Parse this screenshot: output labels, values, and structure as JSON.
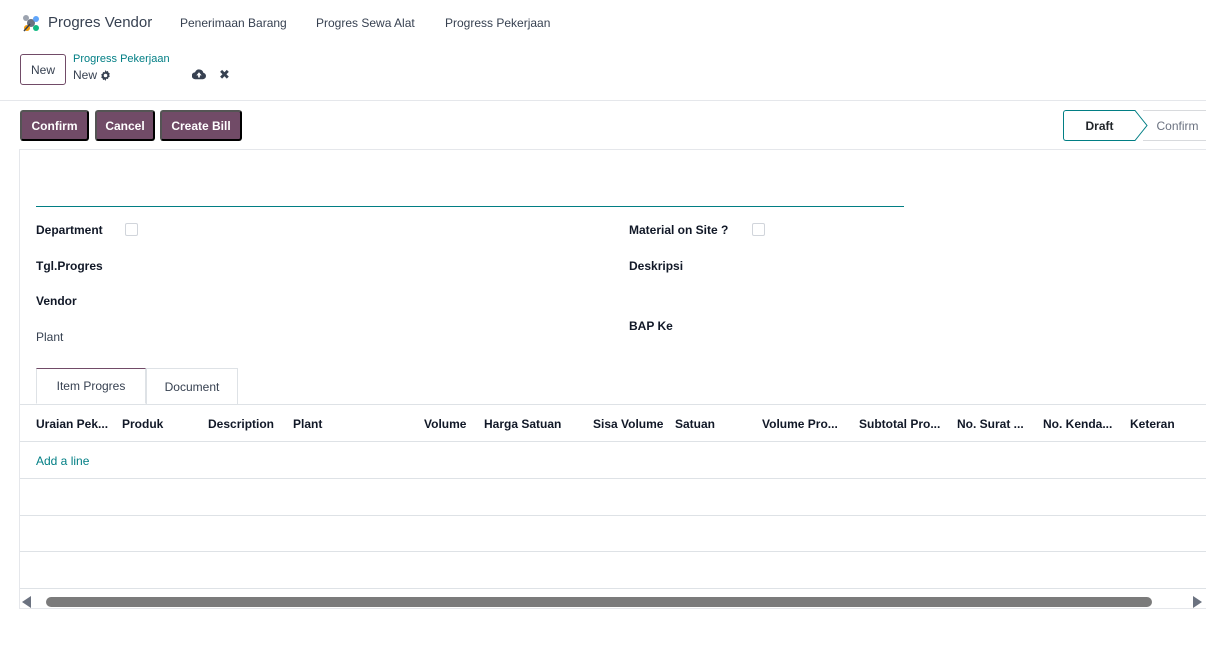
{
  "app": {
    "icon": "app-logo-icon",
    "title": "Progres Vendor",
    "menu": [
      "Penerimaan Barang",
      "Progres Sewa Alat",
      "Progress Pekerjaan"
    ]
  },
  "control_panel": {
    "new_label": "New",
    "breadcrumb": "Progress Pekerjaan",
    "record_name": "New",
    "gear_icon": "gear-icon",
    "save_icon": "cloud-upload-icon",
    "discard_icon": "close-icon"
  },
  "actions": {
    "confirm": "Confirm",
    "cancel": "Cancel",
    "create_bill": "Create Bill"
  },
  "statusbar": {
    "stages": [
      "Draft",
      "Confirm"
    ],
    "current": "Draft"
  },
  "form": {
    "department_label": "Department",
    "tgl_progres_label": "Tgl.Progres",
    "vendor_label": "Vendor",
    "plant_label": "Plant",
    "material_on_site_label": "Material on Site ?",
    "deskripsi_label": "Deskripsi",
    "bap_ke_label": "BAP Ke"
  },
  "tabs": [
    "Item Progres",
    "Document"
  ],
  "table": {
    "columns": [
      "Uraian Pek...",
      "Produk",
      "Description",
      "Plant",
      "Volume",
      "Harga Satuan",
      "Sisa Volume",
      "Satuan",
      "Volume Pro...",
      "Subtotal Pro...",
      "No. Surat ...",
      "No. Kenda...",
      "Keteran"
    ],
    "add_line": "Add a line"
  },
  "colors": {
    "primary": "#714b67",
    "accent": "#017e84"
  }
}
